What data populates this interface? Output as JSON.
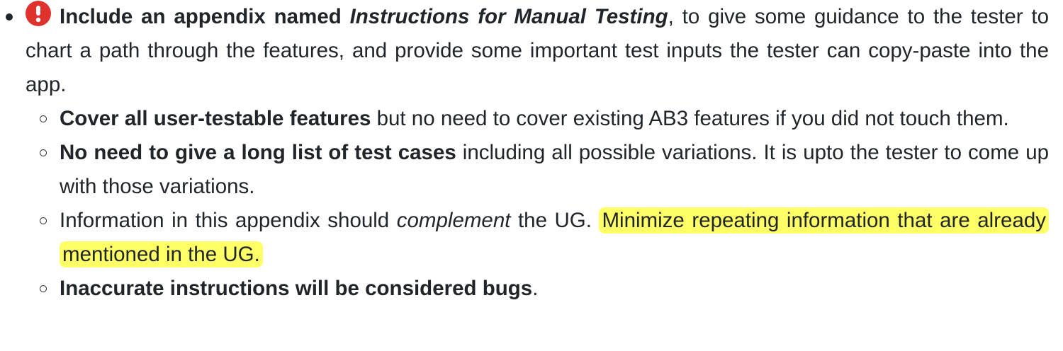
{
  "main_item": {
    "icon": "exclamation-circle-icon",
    "icon_color": "#e0322c",
    "bold_lead": "Include an appendix named",
    "italic_title": "Instructions for Manual Testing",
    "rest": ", to give some guidance to the tester to chart a path through the features, and provide some important test inputs the tester can copy-paste into the app."
  },
  "sub_items": [
    {
      "bold": "Cover all user-testable features",
      "rest": " but no need to cover existing AB3 features if you did not touch them."
    },
    {
      "bold": "No need to give a long list of test cases",
      "rest": " including all possible variations. It is upto the tester to come up with those variations."
    },
    {
      "prefix": "Information in this appendix should ",
      "italic": "complement",
      "middle": " the UG. ",
      "highlight": "Minimize repeating information that are already mentioned in the UG.",
      "highlight_color": "#ffff66"
    },
    {
      "bold": "Inaccurate instructions will be considered bugs",
      "rest": "."
    }
  ]
}
